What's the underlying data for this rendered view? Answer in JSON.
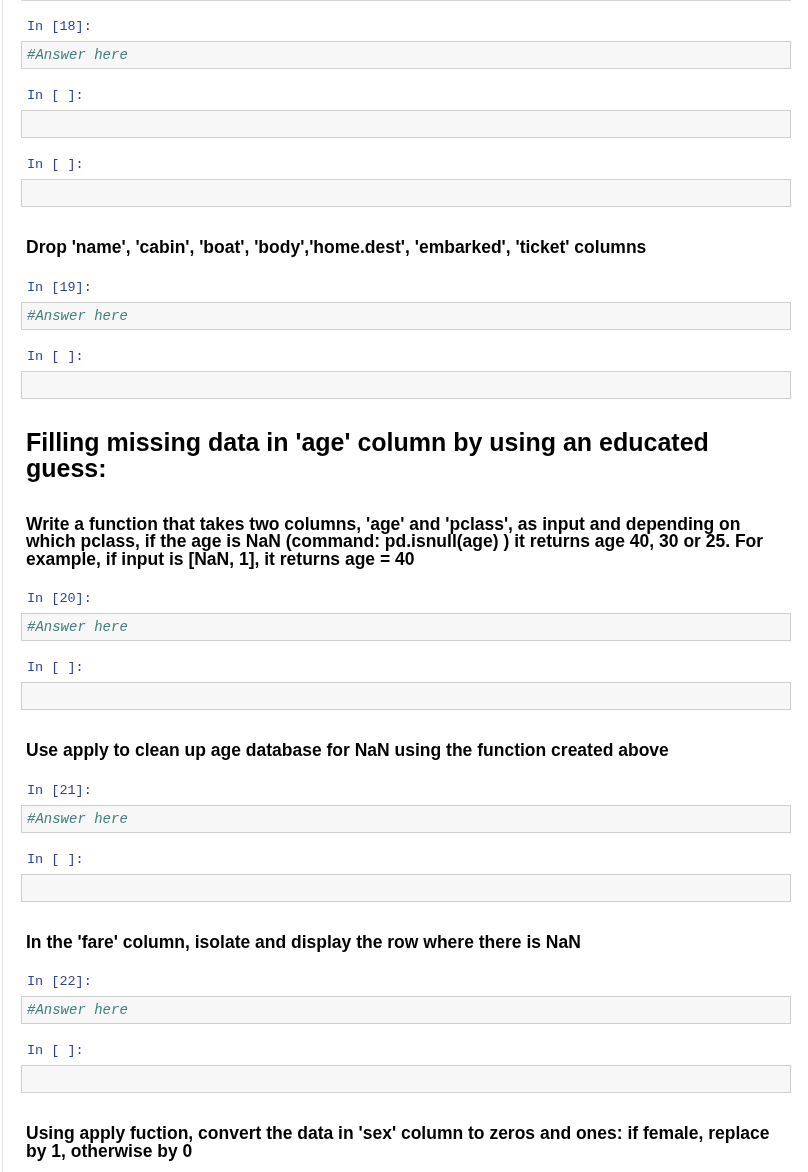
{
  "cells": [
    {
      "kind": "code",
      "prompt": "In [18]:",
      "code": "#Answer here"
    },
    {
      "kind": "code",
      "prompt": "In [ ]:"
    },
    {
      "kind": "code",
      "prompt": "In [ ]:"
    },
    {
      "kind": "task",
      "text": "Drop 'name', 'cabin', 'boat', 'body','home.dest', 'embarked', 'ticket' columns"
    },
    {
      "kind": "code",
      "prompt": "In [19]:",
      "code": "#Answer here"
    },
    {
      "kind": "code",
      "prompt": "In [ ]:"
    },
    {
      "kind": "heading",
      "text": "Filling missing data in 'age' column by using an educated guess:"
    },
    {
      "kind": "task",
      "text": "Write a function that takes two columns, 'age' and 'pclass', as input and depending on which pclass, if the age is NaN (command: pd.isnull(age) ) it returns age 40, 30 or 25. For example, if input is [NaN, 1], it returns age = 40"
    },
    {
      "kind": "code",
      "prompt": "In [20]:",
      "code": "#Answer here"
    },
    {
      "kind": "code",
      "prompt": "In [ ]:"
    },
    {
      "kind": "task",
      "text": "Use apply to clean up age database for NaN using the function created above"
    },
    {
      "kind": "code",
      "prompt": "In [21]:",
      "code": "#Answer here"
    },
    {
      "kind": "code",
      "prompt": "In [ ]:"
    },
    {
      "kind": "task",
      "text": "In the 'fare' column, isolate and display the row where there is NaN"
    },
    {
      "kind": "code",
      "prompt": "In [22]:",
      "code": "#Answer here"
    },
    {
      "kind": "code",
      "prompt": "In [ ]:"
    },
    {
      "kind": "task",
      "text": "Using apply fuction, convert the data in 'sex' column to zeros and ones: if female, replace by 1, otherwise by 0"
    }
  ]
}
